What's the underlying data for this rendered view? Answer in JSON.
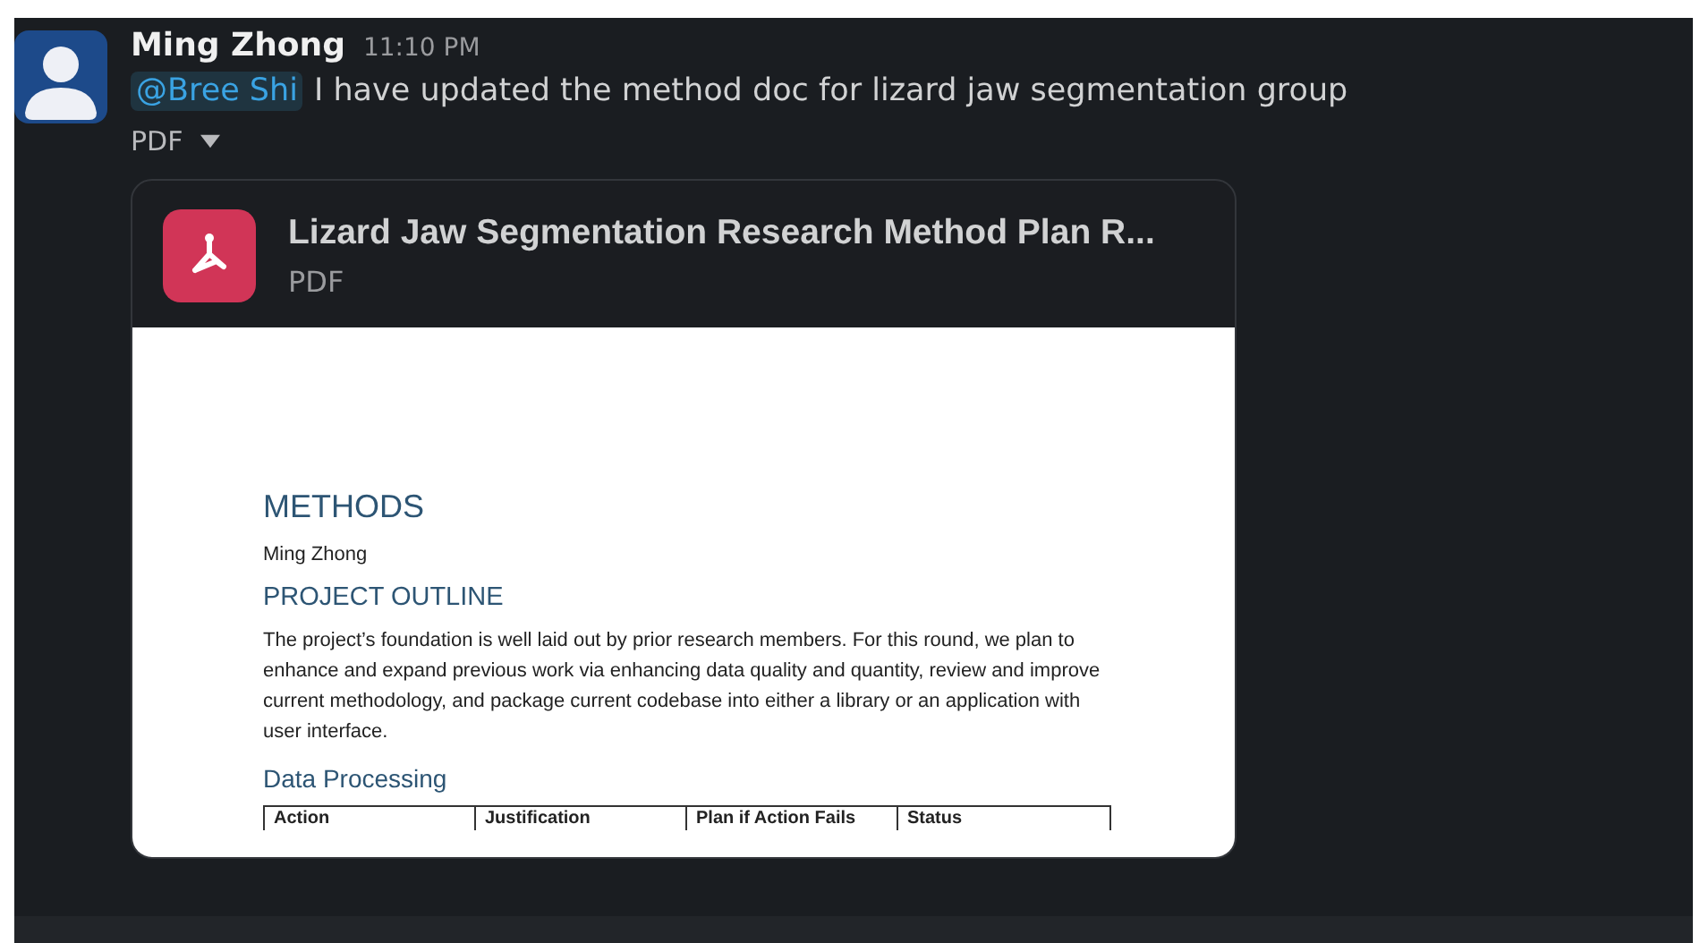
{
  "message": {
    "author": "Ming Zhong",
    "time": "11:10 PM",
    "mention": "@Bree Shi",
    "text": "I have updated the method doc for lizard jaw segmentation group"
  },
  "attachment_toggle": {
    "label": "PDF",
    "expanded": true
  },
  "file": {
    "title": "Lizard Jaw Segmentation Research Method Plan R...",
    "type": "PDF"
  },
  "document": {
    "heading": "METHODS",
    "author": "Ming Zhong",
    "section": "PROJECT OUTLINE",
    "paragraph": "The project’s foundation is well laid out by prior research members. For this round, we plan to enhance and expand previous work via enhancing data quality and quantity, review and improve current methodology, and package current codebase into either a library or an application with user interface.",
    "subsection": "Data Processing",
    "table_columns": [
      "Action",
      "Justification",
      "Plan if Action Fails",
      "Status"
    ]
  }
}
